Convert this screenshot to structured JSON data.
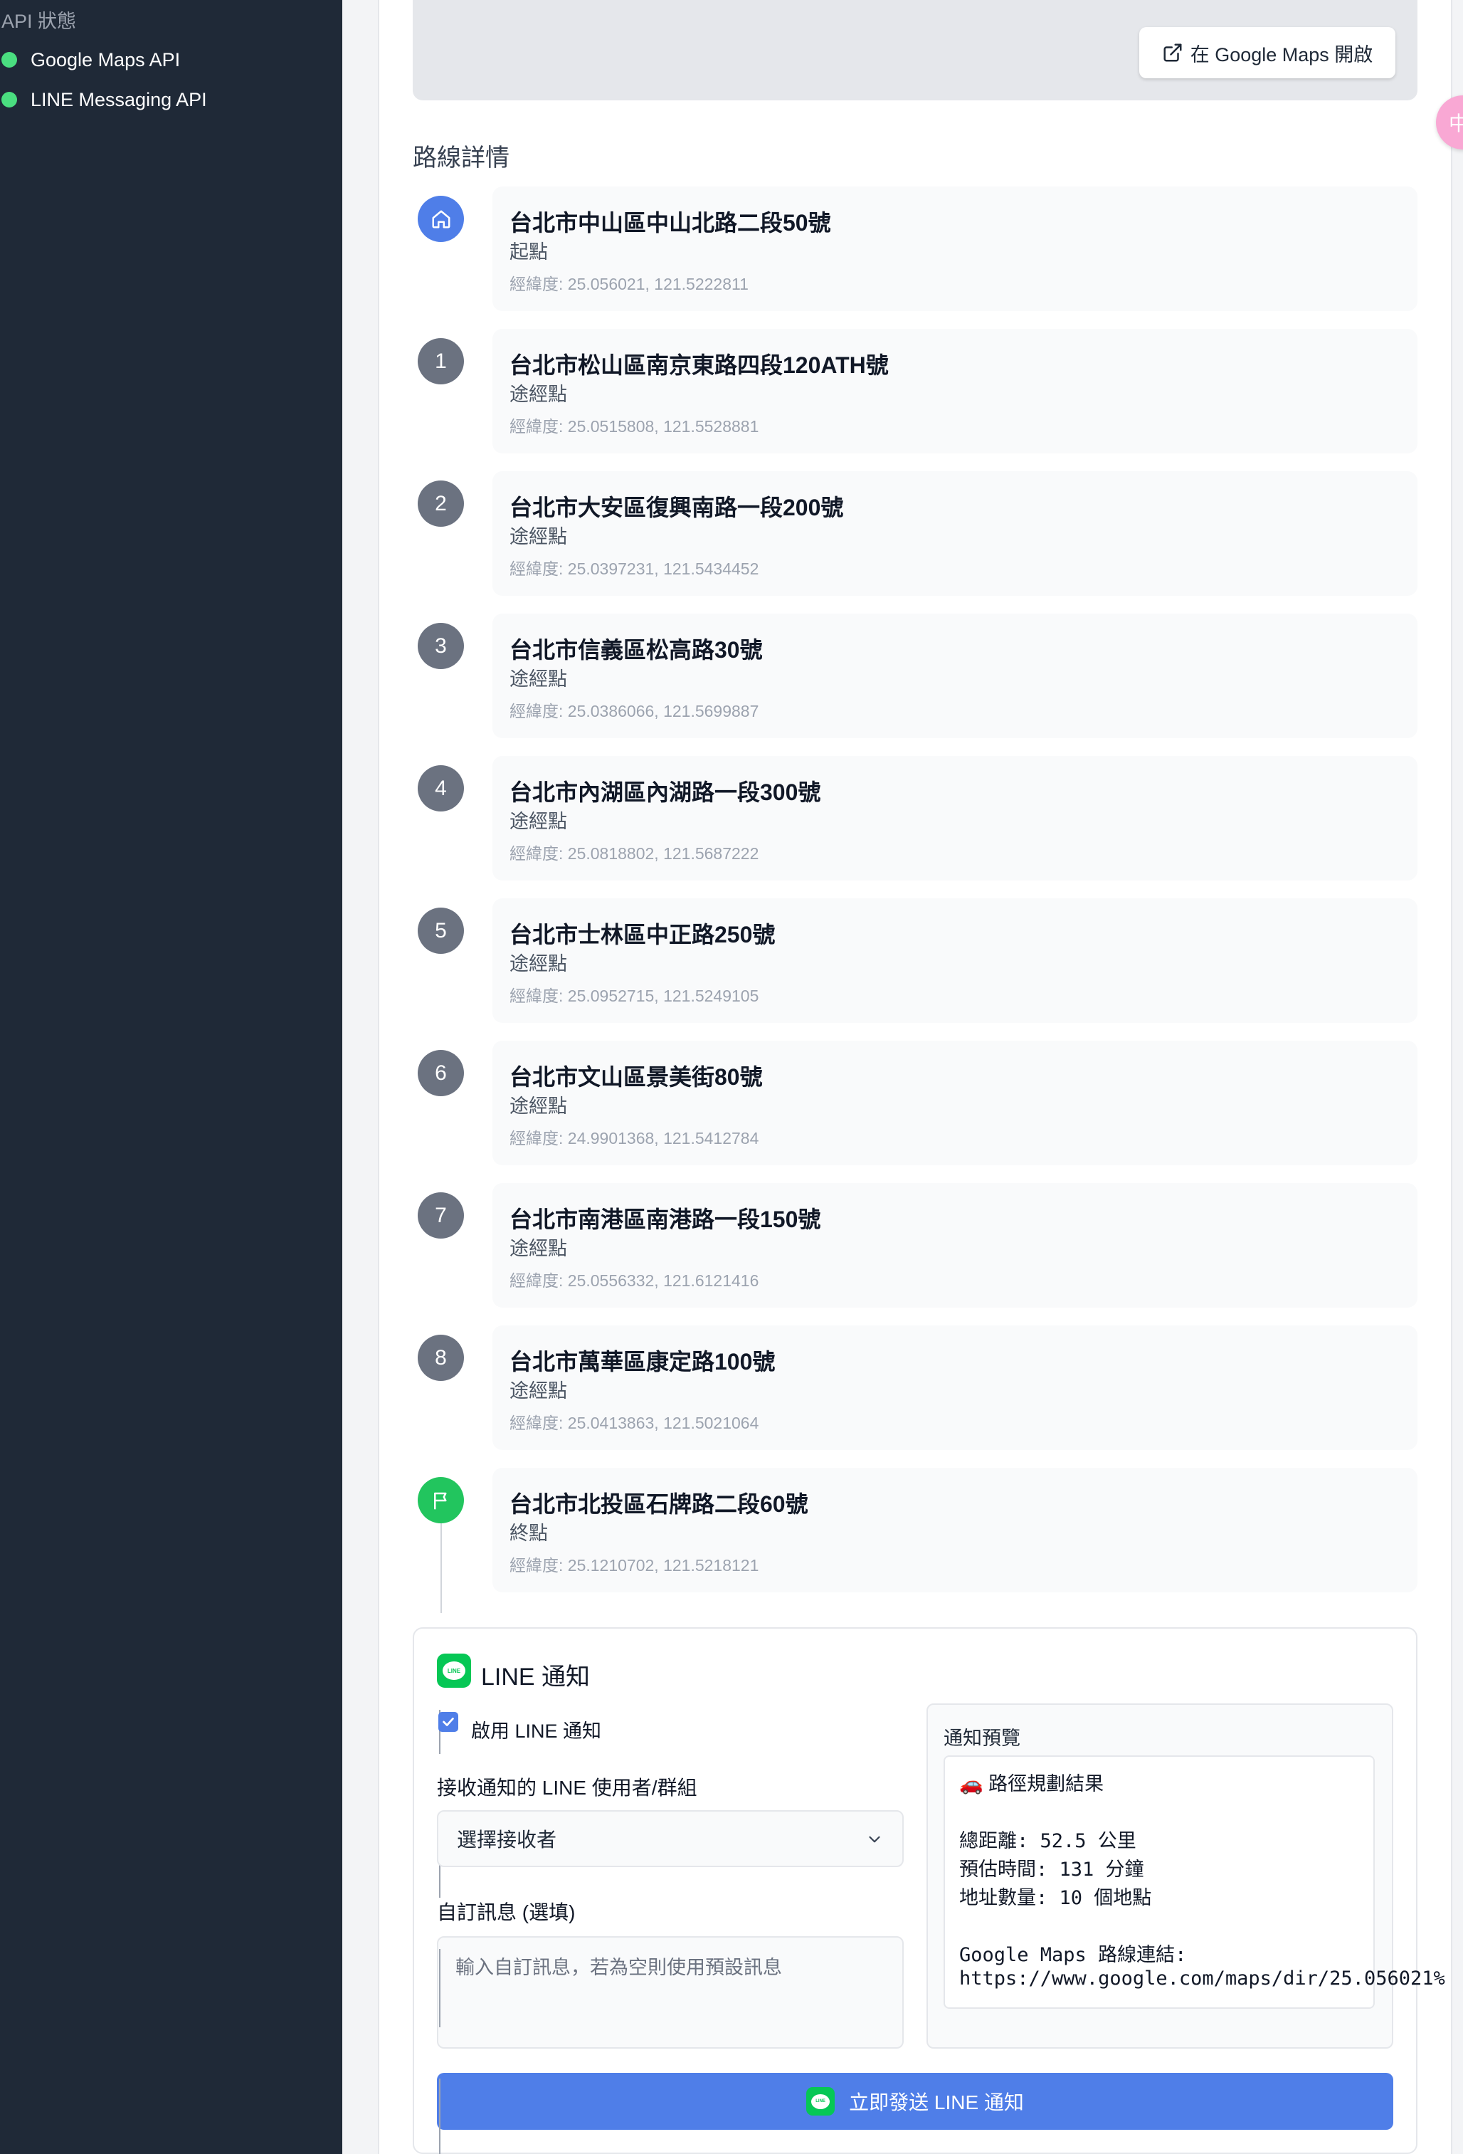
{
  "sidebar": {
    "heading": "API 狀態",
    "items": [
      {
        "label": "Google Maps API",
        "status_color": "#4ade80"
      },
      {
        "label": "LINE Messaging API",
        "status_color": "#4ade80"
      }
    ]
  },
  "map": {
    "open_button_label": "在 Google Maps 開啟",
    "open_button_icon": "external-link-icon"
  },
  "floating_bubble": {
    "text": "中"
  },
  "route": {
    "title": "路線詳情",
    "stops": [
      {
        "marker": "home-icon",
        "address": "台北市中山區中山北路二段50號",
        "type": "起點",
        "coords": "經緯度: 25.056021, 121.5222811"
      },
      {
        "marker": "1",
        "address": "台北市松山區南京東路四段120ATH號",
        "type": "途經點",
        "coords": "經緯度: 25.0515808, 121.5528881"
      },
      {
        "marker": "2",
        "address": "台北市大安區復興南路一段200號",
        "type": "途經點",
        "coords": "經緯度: 25.0397231, 121.5434452"
      },
      {
        "marker": "3",
        "address": "台北市信義區松高路30號",
        "type": "途經點",
        "coords": "經緯度: 25.0386066, 121.5699887"
      },
      {
        "marker": "4",
        "address": "台北市內湖區內湖路一段300號",
        "type": "途經點",
        "coords": "經緯度: 25.0818802, 121.5687222"
      },
      {
        "marker": "5",
        "address": "台北市士林區中正路250號",
        "type": "途經點",
        "coords": "經緯度: 25.0952715, 121.5249105"
      },
      {
        "marker": "6",
        "address": "台北市文山區景美街80號",
        "type": "途經點",
        "coords": "經緯度: 24.9901368, 121.5412784"
      },
      {
        "marker": "7",
        "address": "台北市南港區南港路一段150號",
        "type": "途經點",
        "coords": "經緯度: 25.0556332, 121.6121416"
      },
      {
        "marker": "8",
        "address": "台北市萬華區康定路100號",
        "type": "途經點",
        "coords": "經緯度: 25.0413863, 121.5021064"
      },
      {
        "marker": "flag-icon",
        "address": "台北市北投區石牌路二段60號",
        "type": "終點",
        "coords": "經緯度: 25.1210702, 121.5218121"
      }
    ]
  },
  "line_notify": {
    "title": "LINE 通知",
    "enable_label": "啟用 LINE 通知",
    "enabled": true,
    "recipient_label": "接收通知的 LINE 使用者/群組",
    "recipient_value": "選擇接收者",
    "message_label": "自訂訊息 (選填)",
    "message_placeholder": "輸入自訂訊息，若為空則使用預設訊息",
    "preview_label": "通知預覽",
    "preview_lines": [
      "🚗 路徑規劃結果",
      "總距離: 52.5 公里",
      "預估時間: 131 分鐘",
      "地址數量: 10 個地點",
      "Google Maps 路線連結:",
      "https://www.google.com/maps/dir/25.056021%"
    ],
    "send_label": "立即發送 LINE 通知",
    "brand_color": "#06c755",
    "button_color": "#4f7ee8"
  }
}
